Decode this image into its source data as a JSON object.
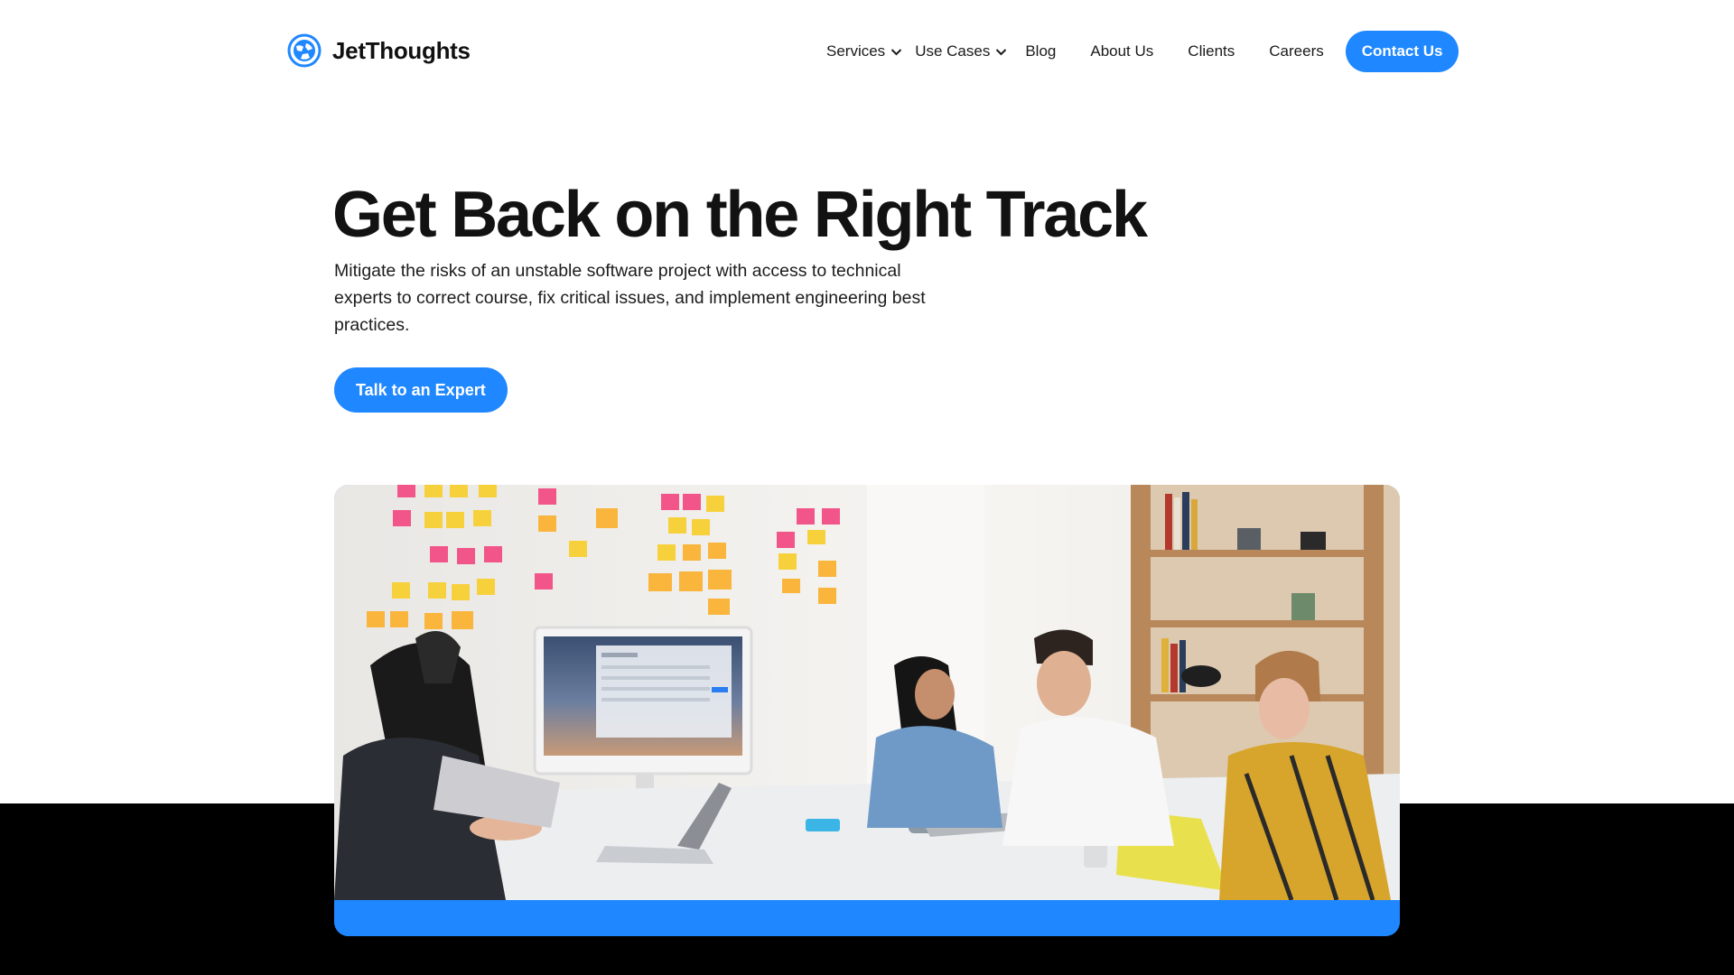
{
  "brand": {
    "name": "JetThoughts",
    "accent": "#1f87ff",
    "logo_icon": "globe-logo-icon"
  },
  "nav": {
    "items": [
      {
        "label": "Services",
        "has_dropdown": true
      },
      {
        "label": "Use Cases",
        "has_dropdown": true
      },
      {
        "label": "Blog"
      },
      {
        "label": "About Us"
      },
      {
        "label": "Clients"
      },
      {
        "label": "Careers"
      }
    ],
    "cta_label": "Contact Us"
  },
  "hero": {
    "title": "Get Back on the Right Track",
    "description": "Mitigate the risks of an unstable software project with access to technical experts to correct course, fix critical issues, and implement engineering best practices.",
    "cta_label": "Talk to an Expert"
  },
  "photo": {
    "subject": "team-meeting-photo",
    "colors": {
      "wall": "#f2f0ec",
      "shelf": "#b8875a",
      "table": "#eceef0",
      "band": "#000000"
    }
  }
}
